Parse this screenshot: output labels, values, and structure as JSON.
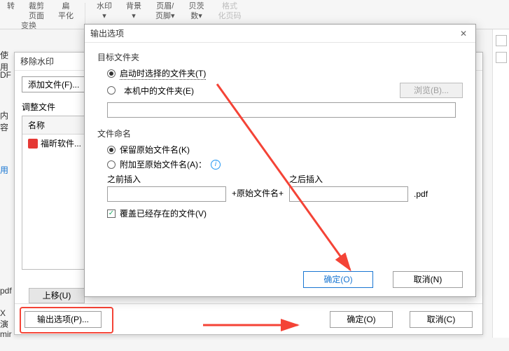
{
  "ribbon": {
    "items": [
      {
        "l1": "转",
        "l2": ""
      },
      {
        "l1": "裁剪",
        "l2": "页面"
      },
      {
        "l1": "扁",
        "l2": "平化"
      },
      {
        "l1": "水印",
        "l2": "▾"
      },
      {
        "l1": "背景",
        "l2": "▾"
      },
      {
        "l1": "页眉/",
        "l2": "页脚▾"
      },
      {
        "l1": "贝茨",
        "l2": "数▾"
      },
      {
        "l1": "格式",
        "l2": "化页码"
      }
    ],
    "group": "变换"
  },
  "leftstubs": {
    "s1": "使用",
    "s2": "DF",
    "s3": "内容",
    "s4": "用",
    "s5": "pdf",
    "s6": "X 演",
    "s7": "mir"
  },
  "removeDialog": {
    "title": "移除水印",
    "addFile": "添加文件(F)...",
    "adjust": "调整文件",
    "colName": "名称",
    "fileRow": "福昕软件...",
    "moveUp": "上移(U)",
    "outputBtn": "输出选项(P)...",
    "ok": "确定(O)",
    "cancel": "取消(C)"
  },
  "outputDialog": {
    "title": "输出选项",
    "targetFolder": "目标文件夹",
    "radioStartup": "启动时选择的文件夹(T)",
    "radioLocal": "本机中的文件夹(E)",
    "browse": "浏览(B)...",
    "fileNaming": "文件命名",
    "radioKeep": "保留原始文件名(K)",
    "radioAppend": "附加至原始文件名(A)：",
    "beforeInsert": "之前插入",
    "afterInsert": "之后插入",
    "origName": "+原始文件名+",
    "ext": ".pdf",
    "overwrite": "覆盖已经存在的文件(V)",
    "ok": "确定(O)",
    "cancel": "取消(N)"
  }
}
